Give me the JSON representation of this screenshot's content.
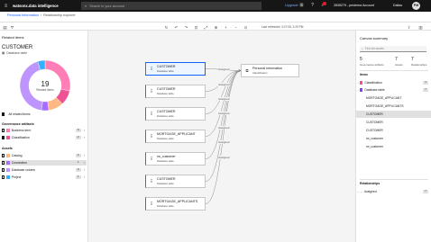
{
  "topbar": {
    "brand": "watsonx.data intelligence",
    "search_placeholder": "Search in your account",
    "upgrade": "Upgrade",
    "notification_count": "",
    "account": "2835279 - pmdema Account",
    "user": "Dallas",
    "avatar": "PM"
  },
  "breadcrumb": {
    "parent": "Personal Information",
    "separator": "/",
    "current": "Relationship explorer"
  },
  "toolbar": {
    "last_refreshed": "Last refreshed: 3:27:05, 3:29 PM"
  },
  "left_panel": {
    "title": "Related items",
    "asset_name": "CUSTOMER",
    "asset_type": "Database table",
    "donut_count": "19",
    "donut_label": "Related items",
    "all_related": "All related items",
    "governance_title": "Governance artifacts",
    "governance": [
      {
        "name": "Business term",
        "count": "6",
        "color": "#ff7eb6",
        "checked": false
      },
      {
        "name": "Classification",
        "count": "2",
        "color": "#ee5396",
        "checked": true
      }
    ],
    "assets_title": "Assets",
    "assets": [
      {
        "name": "Catalog",
        "count": "2",
        "color": "#ffb784",
        "checked": false
      },
      {
        "name": "Connection",
        "count": "1",
        "color": "#a56eff",
        "checked": false
      },
      {
        "name": "Database column",
        "count": "9",
        "color": "#be95ff",
        "checked": false
      },
      {
        "name": "Project",
        "count": "1",
        "color": "#33b1ff",
        "checked": false
      }
    ]
  },
  "chart_data": {
    "type": "pie",
    "categories": [
      "Business term",
      "Classification",
      "Catalog",
      "Connection",
      "Database column",
      "Project"
    ],
    "values": [
      6,
      2,
      2,
      1,
      9,
      1
    ],
    "colors": [
      "#ff7eb6",
      "#ee5396",
      "#ffb784",
      "#a56eff",
      "#be95ff",
      "#33b1ff"
    ]
  },
  "canvas": {
    "nodes": [
      {
        "name": "CUSTOMER",
        "type": "Database table",
        "selected": true
      },
      {
        "name": "CUSTOMER",
        "type": "Database table",
        "selected": false
      },
      {
        "name": "CUSTOMER",
        "type": "Database table",
        "selected": false
      },
      {
        "name": "MORTGAGE_APPLICANT",
        "type": "Database table",
        "selected": false
      },
      {
        "name": "rw_customer",
        "type": "Database table",
        "selected": false
      },
      {
        "name": "CUSTOMER",
        "type": "Database table",
        "selected": false
      },
      {
        "name": "MORTGAGE_APPLICANTS",
        "type": "Database table",
        "selected": false
      }
    ],
    "target": {
      "name": "Personal Information",
      "type": "Classification"
    },
    "edge_label": "Assigned"
  },
  "right_panel": {
    "title": "Canvas summary",
    "search_placeholder": "Find list assets",
    "stats": [
      {
        "value": "5",
        "label": "Governance artifacts"
      },
      {
        "value": "7",
        "label": "Assets"
      },
      {
        "value": "7",
        "label": "Relationships"
      }
    ],
    "items_title": "Items",
    "classification": {
      "name": "Classification",
      "count": "1"
    },
    "db_table": {
      "name": "Database table",
      "count": "7"
    },
    "tables": [
      "MORTGAGE_APPLICANT",
      "MORTGAGE_APPLICANTS",
      "CUSTOMER",
      "CUSTOMER",
      "CUSTOMER",
      "rw_customer",
      "rw_customer"
    ],
    "relationships_title": "Relationships",
    "relationship": {
      "name": "Assigned",
      "count": "7"
    }
  }
}
